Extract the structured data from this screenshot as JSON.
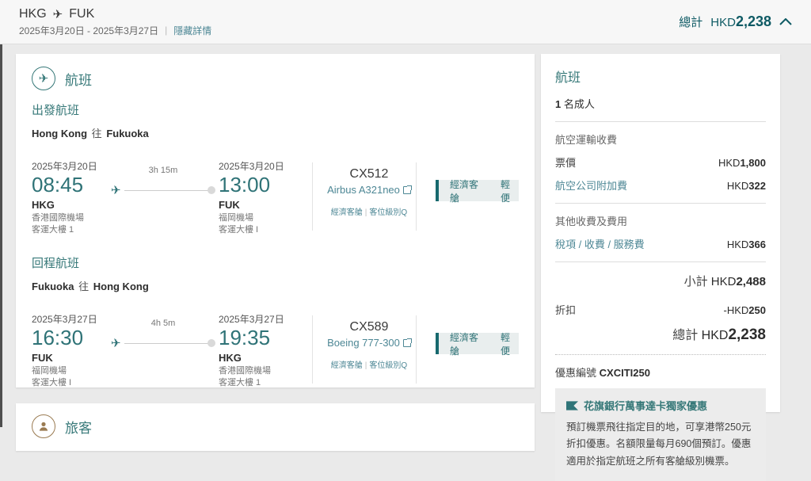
{
  "header": {
    "route_from": "HKG",
    "route_to": "FUK",
    "date_range": "2025年3月20日 - 2025年3月27日",
    "hide_details_label": "隱藏詳情",
    "total_label": "總計",
    "total_currency": "HKD",
    "total_amount": "2,238"
  },
  "flights_card": {
    "title": "航班",
    "departure": {
      "section_label": "出發航班",
      "route": {
        "from": "Hong Kong",
        "mid": "往",
        "to": "Fukuoka"
      },
      "leg": {
        "dep": {
          "date": "2025年3月20日",
          "time": "08:45",
          "code": "HKG",
          "airport": "香港國際機場",
          "terminal": "客運大樓 1"
        },
        "duration": "3h 15m",
        "arr": {
          "date": "2025年3月20日",
          "time": "13:00",
          "code": "FUK",
          "airport": "福岡機場",
          "terminal": "客運大樓 I"
        },
        "flight_no": "CX512",
        "aircraft": "Airbus A321neo",
        "cabin_small": "經濟客艙",
        "booking_class": "客位級別Q",
        "cabin_box": {
          "cabin": "經濟客艙",
          "fare": "輕便"
        }
      }
    },
    "return": {
      "section_label": "回程航班",
      "route": {
        "from": "Fukuoka",
        "mid": "往",
        "to": "Hong Kong"
      },
      "leg": {
        "dep": {
          "date": "2025年3月27日",
          "time": "16:30",
          "code": "FUK",
          "airport": "福岡機場",
          "terminal": "客運大樓 I"
        },
        "duration": "4h 5m",
        "arr": {
          "date": "2025年3月27日",
          "time": "19:35",
          "code": "HKG",
          "airport": "香港國際機場",
          "terminal": "客運大樓 1"
        },
        "flight_no": "CX589",
        "aircraft": "Boeing 777-300",
        "cabin_small": "經濟客艙",
        "booking_class": "客位級別Q",
        "cabin_box": {
          "cabin": "經濟客艙",
          "fare": "輕便"
        }
      }
    }
  },
  "sidebar": {
    "title": "航班",
    "pax_count": "1",
    "pax_label": "名成人",
    "air_charges_label": "航空運輸收費",
    "fare_label": "票價",
    "fare_currency": "HKD",
    "fare_amount": "1,800",
    "surcharge_label": "航空公司附加費",
    "surcharge_currency": "HKD",
    "surcharge_amount": "322",
    "other_charges_label": "其他收費及費用",
    "taxes_label": "稅項 / 收費 / 服務費",
    "taxes_currency": "HKD",
    "taxes_amount": "366",
    "subtotal_label": "小計",
    "subtotal_currency": "HKD",
    "subtotal_amount": "2,488",
    "discount_label": "折扣",
    "discount_prefix": "-HKD",
    "discount_amount": "250",
    "total_label": "總計",
    "total_currency": "HKD",
    "total_amount": "2,238",
    "promo_code_label": "優惠編號",
    "promo_code": "CXCITI250",
    "promo": {
      "title": "花旗銀行萬事達卡獨家優惠",
      "body": "預訂機票飛往指定目的地，可享港幣250元折扣優惠。名額限量每月690個預訂。優惠適用於指定航班之所有客艙級別機票。"
    }
  },
  "passengers_card": {
    "title": "旅客"
  }
}
